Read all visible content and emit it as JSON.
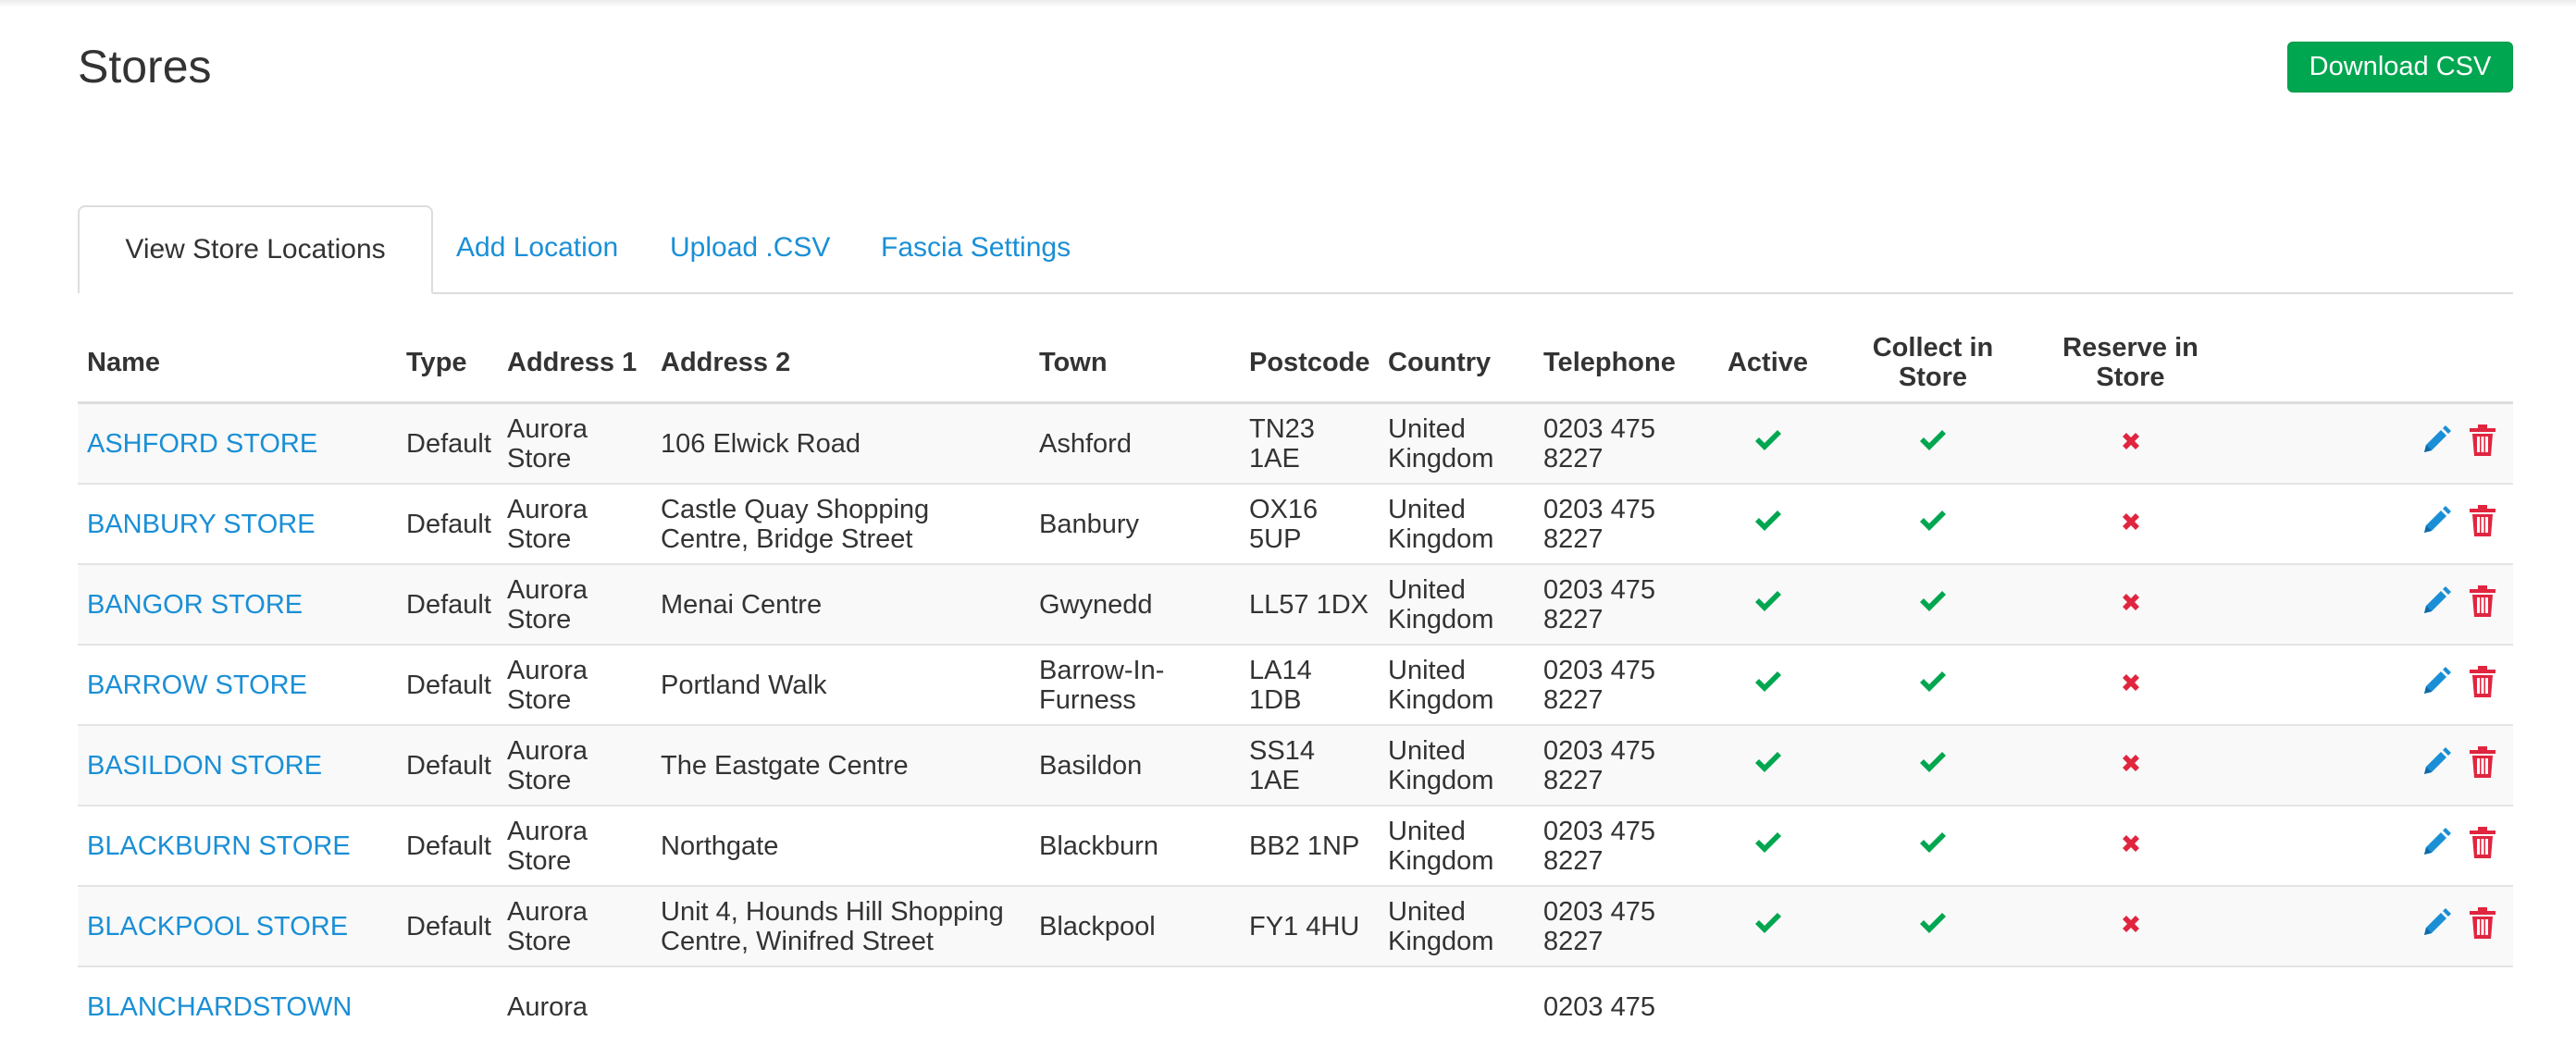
{
  "page": {
    "title": "Stores",
    "download_label": "Download CSV"
  },
  "colors": {
    "accent": "#00a650",
    "link": "#1a8fd6",
    "check": "#00a650",
    "cross": "#e0253f",
    "edit": "#1a8fd6",
    "delete": "#e0253f"
  },
  "tabs": [
    "View Store Locations",
    "Add Location",
    "Upload .CSV",
    "Fascia Settings"
  ],
  "columns": [
    "Name",
    "Type",
    "Address 1",
    "Address 2",
    "Town",
    "Postcode",
    "Country",
    "Telephone",
    "Active",
    "Collect in Store",
    "Reserve in Store"
  ],
  "rows": [
    {
      "name": "ASHFORD STORE",
      "type": "Default",
      "address1": "Aurora Store",
      "address2": "106 Elwick Road",
      "town": "Ashford",
      "postcode": "TN23 1AE",
      "country": "United Kingdom",
      "telephone": "0203 475 8227",
      "active": true,
      "collect": true,
      "reserve": false
    },
    {
      "name": "BANBURY STORE",
      "type": "Default",
      "address1": "Aurora Store",
      "address2": "Castle Quay Shopping Centre, Bridge Street",
      "town": "Banbury",
      "postcode": "OX16 5UP",
      "country": "United Kingdom",
      "telephone": "0203 475 8227",
      "active": true,
      "collect": true,
      "reserve": false
    },
    {
      "name": "BANGOR STORE",
      "type": "Default",
      "address1": "Aurora Store",
      "address2": "Menai Centre",
      "town": "Gwynedd",
      "postcode": "LL57 1DX",
      "country": "United Kingdom",
      "telephone": "0203 475 8227",
      "active": true,
      "collect": true,
      "reserve": false
    },
    {
      "name": "BARROW STORE",
      "type": "Default",
      "address1": "Aurora Store",
      "address2": "Portland Walk",
      "town": "Barrow-In-Furness",
      "postcode": "LA14 1DB",
      "country": "United Kingdom",
      "telephone": "0203 475 8227",
      "active": true,
      "collect": true,
      "reserve": false
    },
    {
      "name": "BASILDON STORE",
      "type": "Default",
      "address1": "Aurora Store",
      "address2": "The Eastgate Centre",
      "town": "Basildon",
      "postcode": "SS14 1AE",
      "country": "United Kingdom",
      "telephone": "0203 475 8227",
      "active": true,
      "collect": true,
      "reserve": false
    },
    {
      "name": "BLACKBURN STORE",
      "type": "Default",
      "address1": "Aurora Store",
      "address2": "Northgate",
      "town": "Blackburn",
      "postcode": "BB2 1NP",
      "country": "United Kingdom",
      "telephone": "0203 475 8227",
      "active": true,
      "collect": true,
      "reserve": false
    },
    {
      "name": "BLACKPOOL STORE",
      "type": "Default",
      "address1": "Aurora Store",
      "address2": "Unit 4, Hounds Hill Shopping Centre, Winifred Street",
      "town": "Blackpool",
      "postcode": "FY1 4HU",
      "country": "United Kingdom",
      "telephone": "0203 475 8227",
      "active": true,
      "collect": true,
      "reserve": false
    },
    {
      "name": "BLANCHARDSTOWN",
      "type": "",
      "address1": "Aurora",
      "address2": "",
      "town": "",
      "postcode": "",
      "country": "",
      "telephone": "0203 475",
      "active": null,
      "collect": null,
      "reserve": null
    }
  ]
}
